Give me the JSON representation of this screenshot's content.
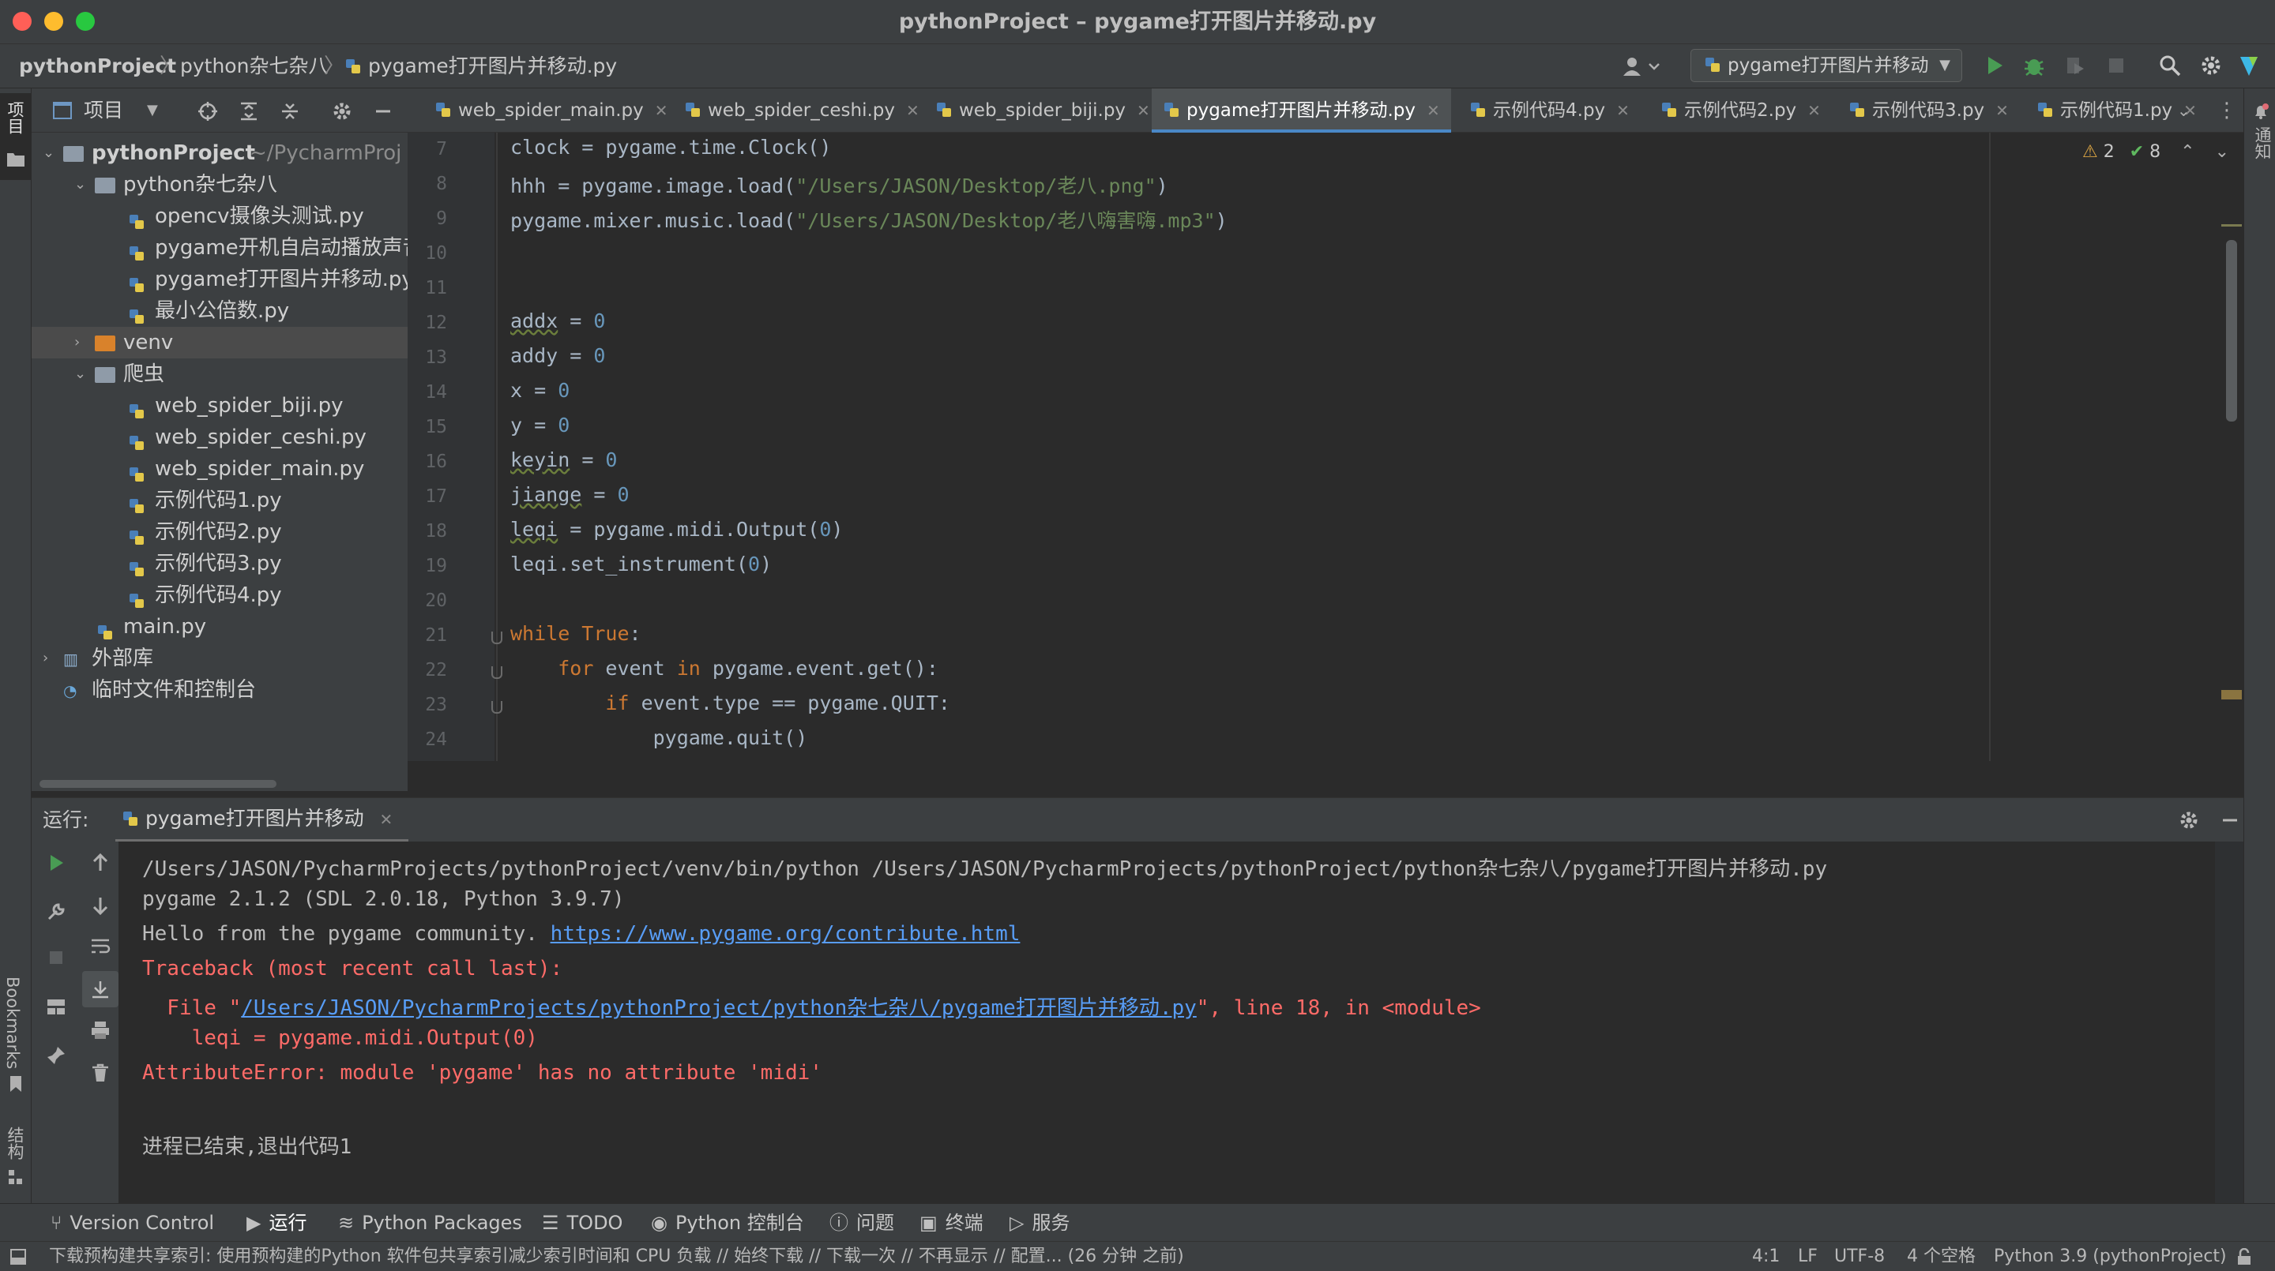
{
  "window": {
    "title": "pythonProject – pygame打开图片并移动.py"
  },
  "breadcrumb": [
    "pythonProject",
    "python杂七杂八",
    "pygame打开图片并移动.py"
  ],
  "run_config": {
    "name": "pygame打开图片并移动"
  },
  "project_panel": {
    "title": "项目",
    "tree": [
      {
        "label": "pythonProject",
        "extra": "~/PycharmProj",
        "type": "folder",
        "level": 0,
        "expanded": true
      },
      {
        "label": "python杂七杂八",
        "type": "folder",
        "level": 1,
        "expanded": true
      },
      {
        "label": "opencv摄像头测试.py",
        "type": "py",
        "level": 2
      },
      {
        "label": "pygame开机自启动播放声音",
        "type": "py",
        "level": 2
      },
      {
        "label": "pygame打开图片并移动.py",
        "type": "py",
        "level": 2
      },
      {
        "label": "最小公倍数.py",
        "type": "py",
        "level": 2
      },
      {
        "label": "venv",
        "type": "folder-orange",
        "level": 1,
        "expanded": false,
        "selected": true
      },
      {
        "label": "爬虫",
        "type": "folder",
        "level": 1,
        "expanded": true
      },
      {
        "label": "web_spider_biji.py",
        "type": "py",
        "level": 2
      },
      {
        "label": "web_spider_ceshi.py",
        "type": "py",
        "level": 2
      },
      {
        "label": "web_spider_main.py",
        "type": "py",
        "level": 2
      },
      {
        "label": "示例代码1.py",
        "type": "py",
        "level": 2
      },
      {
        "label": "示例代码2.py",
        "type": "py",
        "level": 2
      },
      {
        "label": "示例代码3.py",
        "type": "py",
        "level": 2
      },
      {
        "label": "示例代码4.py",
        "type": "py",
        "level": 2
      },
      {
        "label": "main.py",
        "type": "py",
        "level": 1
      },
      {
        "label": "外部库",
        "type": "lib",
        "level": 0,
        "expanded": false
      },
      {
        "label": "临时文件和控制台",
        "type": "scratch",
        "level": 0
      }
    ]
  },
  "tabs": [
    {
      "label": "web_spider_main.py"
    },
    {
      "label": "web_spider_ceshi.py"
    },
    {
      "label": "web_spider_biji.py"
    },
    {
      "label": "pygame打开图片并移动.py",
      "active": true
    },
    {
      "label": "示例代码4.py"
    },
    {
      "label": "示例代码2.py"
    },
    {
      "label": "示例代码3.py"
    },
    {
      "label": "示例代码1.py"
    }
  ],
  "inspections": {
    "warnings": "2",
    "ok": "8"
  },
  "code_lines": [
    {
      "n": "7",
      "html": "clock = pygame.time.Clock()"
    },
    {
      "n": "8",
      "html": "hhh = pygame.image.load(<span class=\"str\">\"/Users/JASON/Desktop/老八.png\"</span>)"
    },
    {
      "n": "9",
      "html": "pygame.mixer.music.load(<span class=\"str\">\"/Users/JASON/Desktop/老八嗨害嗨.mp3\"</span>)"
    },
    {
      "n": "10",
      "html": ""
    },
    {
      "n": "11",
      "html": ""
    },
    {
      "n": "12",
      "html": "<span class=\"ul\">addx</span> = <span class=\"num\">0</span>"
    },
    {
      "n": "13",
      "html": "addy = <span class=\"num\">0</span>"
    },
    {
      "n": "14",
      "html": "x = <span class=\"num\">0</span>"
    },
    {
      "n": "15",
      "html": "y = <span class=\"num\">0</span>"
    },
    {
      "n": "16",
      "html": "<span class=\"ul\">keyin</span> = <span class=\"num\">0</span>"
    },
    {
      "n": "17",
      "html": "<span class=\"ul\">jiange</span> = <span class=\"num\">0</span>"
    },
    {
      "n": "18",
      "html": "<span class=\"ul\">leqi</span> = pygame.midi.Output(<span class=\"num\">0</span>)"
    },
    {
      "n": "19",
      "html": "leqi.set_instrument(<span class=\"num\">0</span>)"
    },
    {
      "n": "20",
      "html": ""
    },
    {
      "n": "21",
      "html": "<span class=\"kw\">while True</span>:"
    },
    {
      "n": "22",
      "html": "    <span class=\"kw\">for</span> event <span class=\"kw\">in</span> pygame.event.get():"
    },
    {
      "n": "23",
      "html": "        <span class=\"kw\">if</span> event.type == pygame.QUIT:"
    },
    {
      "n": "24",
      "html": "            pygame.quit()"
    }
  ],
  "run_panel": {
    "label": "运行:",
    "tab": "pygame打开图片并移动",
    "output": [
      {
        "text": "/Users/JASON/PycharmProjects/pythonProject/venv/bin/python /Users/JASON/PycharmProjects/pythonProject/python杂七杂八/pygame打开图片并移动.py",
        "cls": ""
      },
      {
        "text": "pygame 2.1.2 (SDL 2.0.18, Python 3.9.7)",
        "cls": ""
      },
      {
        "text": "Hello from the pygame community. ",
        "link": "https://www.pygame.org/contribute.html",
        "cls": ""
      },
      {
        "text": "Traceback (most recent call last):",
        "cls": "red"
      },
      {
        "text": "  File \"",
        "link": "/Users/JASON/PycharmProjects/pythonProject/python杂七杂八/pygame打开图片并移动.py",
        "after": "\", line 18, in <module>",
        "cls": "red"
      },
      {
        "text": "    leqi = pygame.midi.Output(0)",
        "cls": "red"
      },
      {
        "text": "AttributeError: module 'pygame' has no attribute 'midi'",
        "cls": "red"
      },
      {
        "text": "",
        "cls": ""
      },
      {
        "text": "进程已结束,退出代码1",
        "cls": ""
      }
    ]
  },
  "bottom_tabs": [
    "Version Control",
    "运行",
    "Python Packages",
    "TODO",
    "Python 控制台",
    "问题",
    "终端",
    "服务"
  ],
  "side_labels": {
    "project": "项目",
    "bookmarks": "Bookmarks",
    "structure": "结构",
    "notifications": "通知"
  },
  "status": {
    "message": "下载预构建共享索引: 使用预构建的Python 软件包共享索引减少索引时间和 CPU 负载 // 始终下载 // 下载一次 // 不再显示 // 配置... (26 分钟 之前)",
    "position": "4:1",
    "line_sep": "LF",
    "encoding": "UTF-8",
    "indent": "4 个空格",
    "interpreter": "Python 3.9 (pythonProject)"
  },
  "colors": {
    "accent": "#4a88c7",
    "error": "#ff6b68",
    "link": "#589df6",
    "run_green": "#499c54"
  }
}
